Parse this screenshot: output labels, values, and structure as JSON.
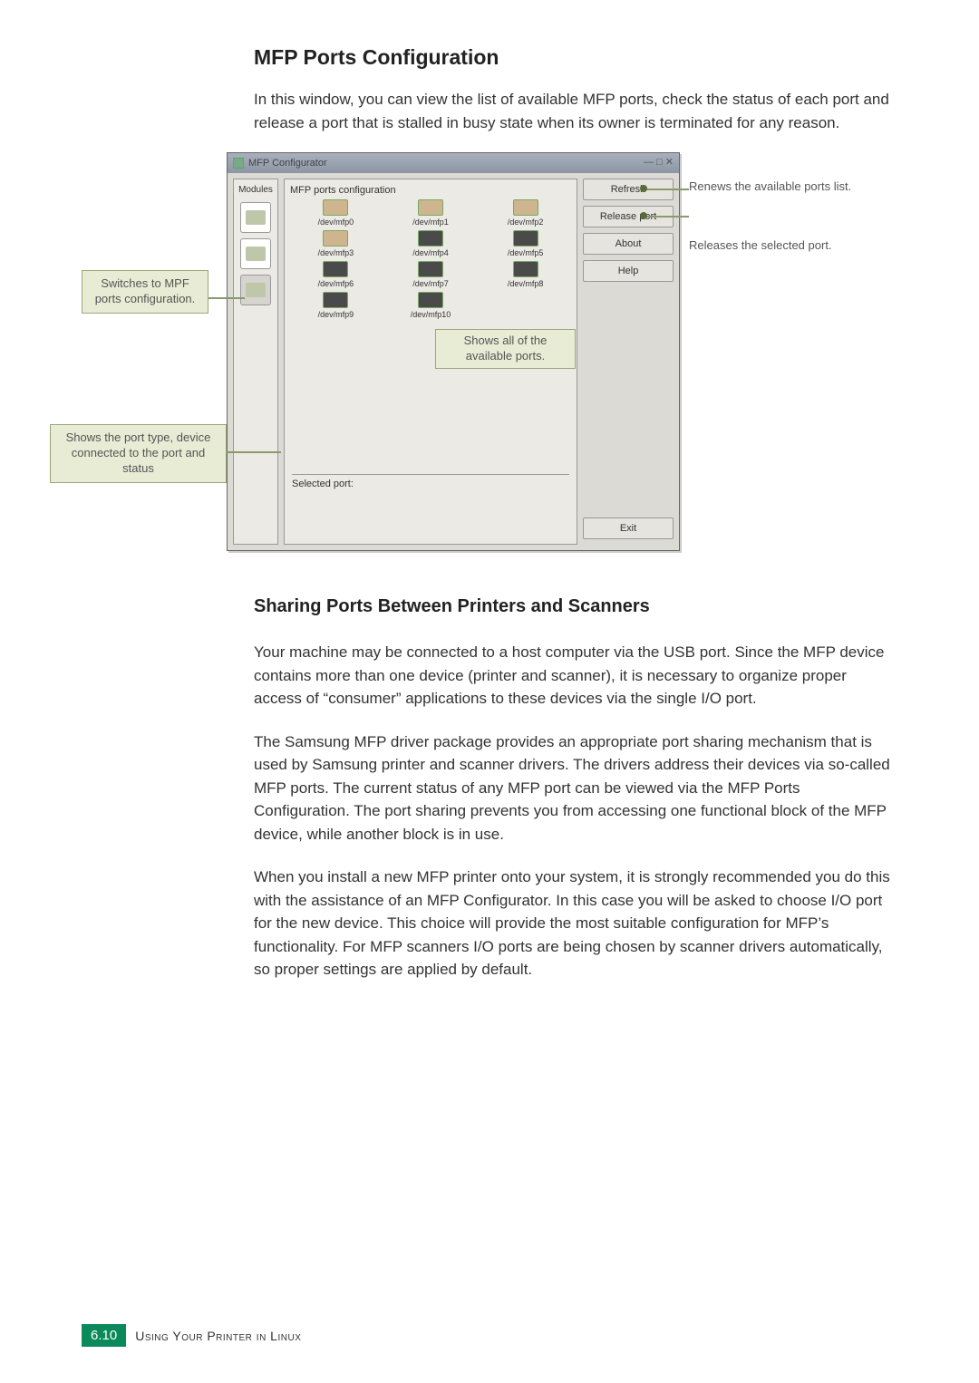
{
  "title": "MFP Ports Configuration",
  "intro": "In this window, you can view the list of available MFP ports, check the status of each port and release a port that is stalled in busy state when its owner is terminated for any reason.",
  "window": {
    "title": "MFP Configurator",
    "modules_label": "Modules",
    "fieldset": "MFP ports configuration",
    "ports": [
      "/dev/mfp0",
      "/dev/mfp1",
      "/dev/mfp2",
      "/dev/mfp3",
      "/dev/mfp4",
      "/dev/mfp5",
      "/dev/mfp6",
      "/dev/mfp7",
      "/dev/mfp8",
      "/dev/mfp9",
      "/dev/mfp10"
    ],
    "selected_port_label": "Selected port:",
    "buttons": {
      "refresh": "Refresh",
      "release": "Release port",
      "about": "About",
      "help": "Help",
      "exit": "Exit"
    }
  },
  "callouts": {
    "switches": "Switches to MPF ports configuration.",
    "port_type": "Shows the port type, device connected to the port and status",
    "shows_all": "Shows all of the available ports.",
    "renews": "Renews the available ports list.",
    "releases": "Releases the selected port."
  },
  "subheading": "Sharing Ports Between Printers and Scanners",
  "para1": "Your machine may be connected to a host computer via the USB port. Since the MFP device contains more than one device (printer and scanner), it is necessary to organize proper access of “consumer” applications to these devices via the single I/O port.",
  "para2": "The Samsung MFP driver package provides an appropriate port sharing mechanism that is used by Samsung printer and scanner drivers. The drivers address their devices via so-called MFP ports. The current status of any MFP port can be viewed via the MFP Ports Configuration. The port sharing prevents you from accessing one functional block of the MFP device, while another block is in use.",
  "para3": "When you install a new MFP printer onto your system, it is strongly recommended you do this with the assistance of an MFP Configurator. In this case you will be asked to choose I/O port for the new device. This choice will provide the most suitable configuration for MFP’s functionality. For MFP scanners I/O ports are being chosen by scanner drivers automatically, so proper settings are applied by default.",
  "footer": {
    "page": "6.10",
    "chapter": "Using Your Printer in Linux"
  }
}
